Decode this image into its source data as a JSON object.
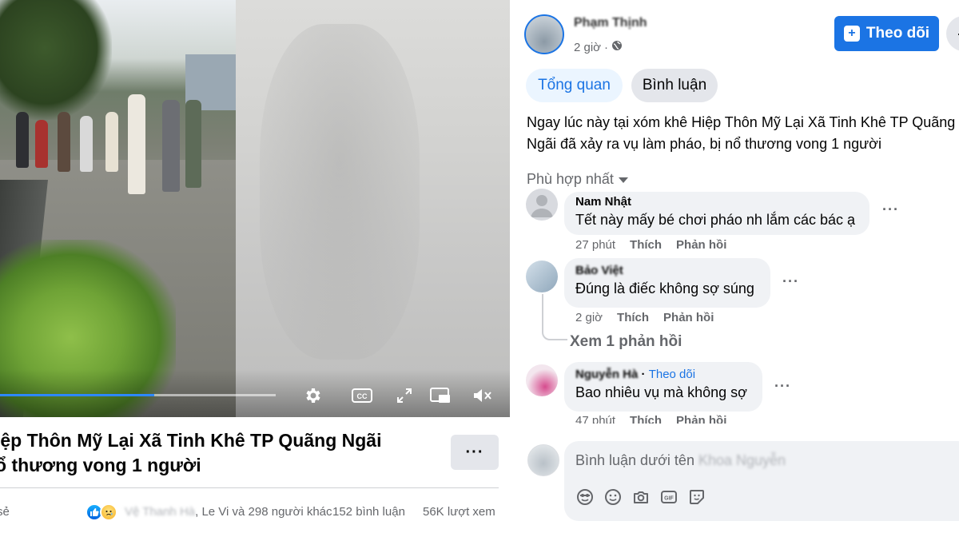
{
  "video": {
    "progress_fraction": 0.56
  },
  "post": {
    "title_line1": "iệp Thôn Mỹ Lại Xã Tinh Khê TP Quãng Ngãi",
    "title_line2": "ổ thương vong 1 người",
    "more_label": "···"
  },
  "stats": {
    "share_label": "sẻ",
    "reactors_blurred": "Vệ Thanh Hà",
    "reactors": ", Le Vi và 298 người khác",
    "comments": "152 bình luận",
    "views": "56K lượt xem"
  },
  "author": {
    "name": "Phạm Thịnh",
    "time": "2 giờ",
    "follow_label": "Theo dõi"
  },
  "tabs": [
    {
      "label": "Tổng quan",
      "active": true
    },
    {
      "label": "Bình luận",
      "active": false
    }
  ],
  "caption": "Ngay lúc này tại xóm khê Hiệp Thôn Mỹ Lại Xã Tinh Khê TP Quãng Ngãi đã xảy ra vụ làm pháo, bị nổ thương vong 1 người",
  "sort_label": "Phù hợp nhất",
  "comments": [
    {
      "name": "Nam Nhật",
      "text": "Tết này mấy bé chơi pháo nh lắm các bác ạ",
      "time": "27 phút",
      "like": "Thích",
      "reply": "Phản hồi"
    },
    {
      "name": "Bảo Việt",
      "text": "Đúng là điếc không sợ súng",
      "time": "2 giờ",
      "like": "Thích",
      "reply": "Phản hồi",
      "replies_label": "Xem 1 phản hồi"
    },
    {
      "name": "Nguyễn Hà",
      "follow": "Theo dõi",
      "text": "Bao nhiêu vụ mà không sợ",
      "time": "47 phút",
      "like": "Thích",
      "reply": "Phản hồi"
    }
  ],
  "compose": {
    "placeholder": "Bình luận dưới tên",
    "user_blurred": "Khoa Nguyễn"
  },
  "colors": {
    "accent": "#1b74e4",
    "progress": "#2d88ff",
    "bubble": "#f0f2f5",
    "secondary_text": "#65676b"
  }
}
